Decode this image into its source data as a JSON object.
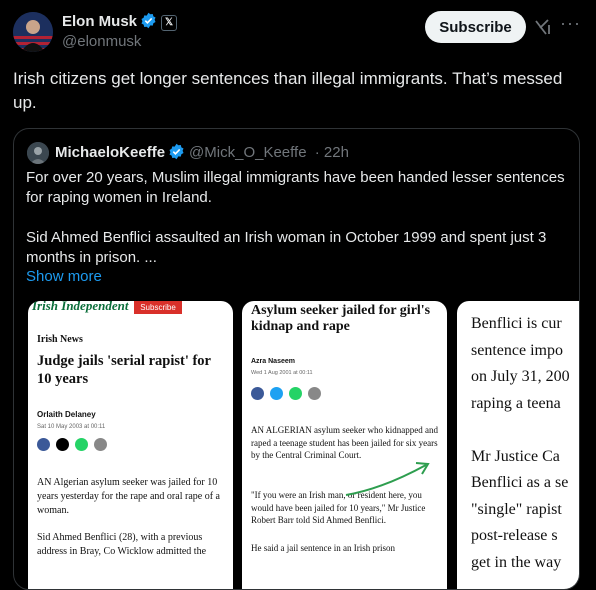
{
  "author": {
    "name": "Elon Musk",
    "handle": "@elonmusk",
    "x_badge": "𝕏"
  },
  "header": {
    "subscribe_label": "Subscribe",
    "more_label": "···"
  },
  "tweet": {
    "text": "Irish citizens get longer sentences than illegal immigrants. That’s messed up."
  },
  "quote": {
    "name": "MichaeloKeeffe",
    "handle": "@Mick_O_Keeffe",
    "time": "· 22h",
    "paragraph1": "For over 20 years, Muslim illegal immigrants have been handed lesser sentences for raping women in Ireland.",
    "paragraph2": "Sid Ahmed Benflici assaulted an Irish woman in October 1999 and spent just 3 months in prison. ...",
    "show_more": "Show more"
  },
  "card1": {
    "masthead": "Irish Independent",
    "subscribe": "Subscribe",
    "section": "Irish News",
    "headline": "Judge jails 'serial rapist' for 10 years",
    "byline": "Orlaith Delaney",
    "date": "Sat 10 May 2003 at 00:11",
    "para1": "AN Algerian asylum seeker was jailed for 10 years yesterday for the rape and oral rape of a woman.",
    "para2": "Sid Ahmed Benflici (28), with a previous address in Bray, Co Wicklow admitted the"
  },
  "card2": {
    "headline": "Asylum seeker jailed for girl's kidnap and rape",
    "byline": "Azra Naseem",
    "date": "Wed 1 Aug 2001 at 00:11",
    "para1": "AN ALGERIAN asylum seeker who kidnapped and raped a teenage student has been jailed for six years by the Central Criminal Court.",
    "para2": "\"If you were an Irish man, or resident here, you would have been jailed for 10 years,\" Mr Justice Robert Barr told Sid Ahmed Benflici.",
    "para3": "He said a jail sentence in an Irish prison"
  },
  "card3": {
    "lines": [
      "Benflici is cur",
      "sentence impo",
      "on July 31, 200",
      "raping a teena",
      "",
      "Mr Justice Ca",
      "Benflici as a se",
      "\"single\" rapist",
      "post-release s",
      "get in the way"
    ]
  },
  "colors": {
    "accent": "#1d9bf0",
    "background": "#000000",
    "muted": "#71767b",
    "border": "#2f3336",
    "annotation": "#2e9e4f"
  }
}
